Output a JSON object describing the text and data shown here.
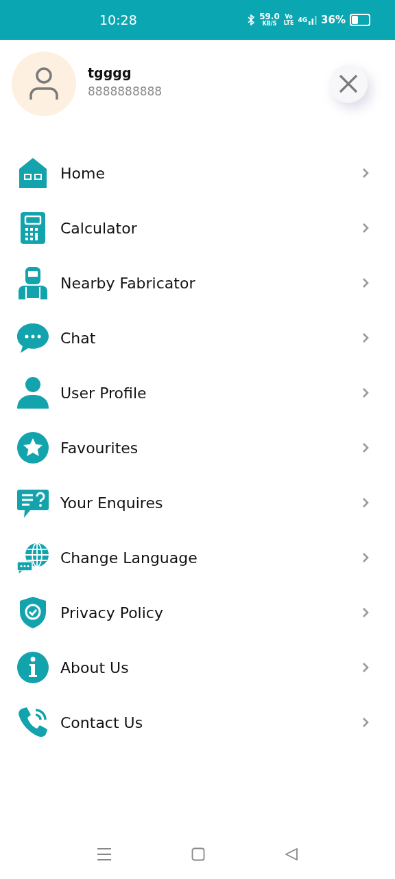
{
  "status_bar": {
    "time": "10:28",
    "speed": "59.0",
    "speed_unit": "KB/S",
    "volte_top": "Vo",
    "volte_bottom": "LTE",
    "network": "4G",
    "battery": "36%"
  },
  "profile": {
    "name": "tgggg",
    "phone": "8888888888"
  },
  "menu": [
    {
      "label": "Home"
    },
    {
      "label": "Calculator"
    },
    {
      "label": "Nearby Fabricator"
    },
    {
      "label": "Chat"
    },
    {
      "label": "User Profile"
    },
    {
      "label": "Favourites"
    },
    {
      "label": "Your Enquires"
    },
    {
      "label": "Change Language"
    },
    {
      "label": "Privacy Policy"
    },
    {
      "label": "About Us"
    },
    {
      "label": "Contact Us"
    }
  ]
}
